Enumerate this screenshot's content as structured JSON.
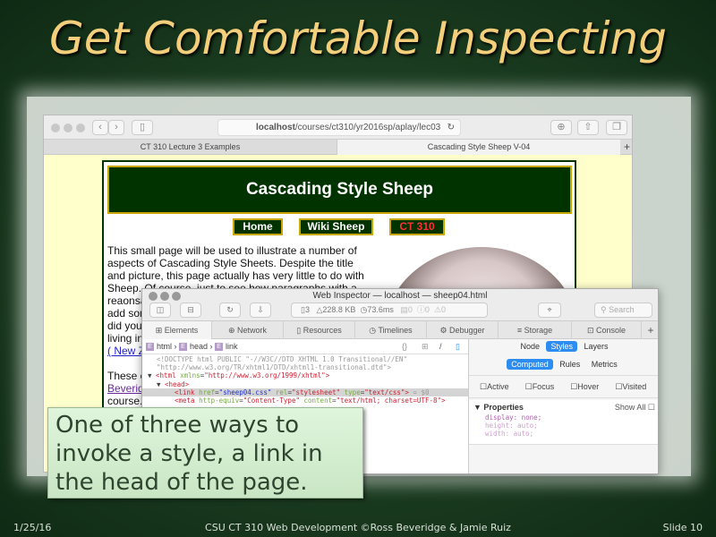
{
  "slide": {
    "title": "Get Comfortable Inspecting",
    "callout": "One of three ways to invoke a style, a link in the head of the page.",
    "footer_date": "1/25/16",
    "footer_center": "CSU CT 310 Web Development ©Ross Beveridge & Jamie Ruiz",
    "footer_slide": "Slide 10"
  },
  "browser": {
    "url_host": "localhost",
    "url_path": "/courses/ct310/yr2016sp/aplay/lec03",
    "tabs": [
      "CT 310 Lecture 3 Examples",
      "Cascading Style Sheep V-04"
    ],
    "new_tab": "+"
  },
  "page": {
    "heading": "Cascading Style Sheep",
    "nav": [
      "Home",
      "Wiki Sheep",
      "CT 310"
    ],
    "para1_lines": [
      "This small page will be used to illustrate a number of",
      "aspects of Cascading Style Sheets. Despite the title",
      "and picture, this page actually has very little to do with",
      "Sheep. Of course, just to see how paragraphs with a",
      "reaonsa",
      "add som",
      "did you",
      "living in"
    ],
    "link1": "( New Z",
    "para2": "These e",
    "link2": "Beveridg",
    "para2_end": "course."
  },
  "inspector": {
    "title": "Web Inspector — localhost — sheep04.html",
    "stats": {
      "resources": "3",
      "size": "228.8 KB",
      "time": "73.6ms",
      "logs": "0",
      "errors": "0",
      "warnings": "0"
    },
    "search_placeholder": "Search",
    "tabs": [
      "Elements",
      "Network",
      "Resources",
      "Timelines",
      "Debugger",
      "Storage",
      "Console"
    ],
    "breadcrumbs": [
      "html",
      "head",
      "link"
    ],
    "dom": {
      "doctype1": "<!DOCTYPE html PUBLIC \"-//W3C//DTD XHTML 1.0 Transitional//EN\"",
      "doctype2": "\"http://www.w3.org/TR/xhtml1/DTD/xhtml1-transitional.dtd\">",
      "html_xmlns": "http://www.w3.org/1999/xhtml",
      "link_href": "sheep04.css",
      "link_rel": "stylesheet",
      "link_type": "text/css",
      "sel_marker": "= $0",
      "meta_equiv": "Content-Type",
      "meta_content": "text/html; charset=UTF-8"
    },
    "side_tabs": [
      "Node",
      "Styles",
      "Layers"
    ],
    "sub_tabs": [
      "Computed",
      "Rules",
      "Metrics"
    ],
    "states": [
      "Active",
      "Focus",
      "Hover",
      "Visited"
    ],
    "properties_label": "Properties",
    "show_all": "Show All",
    "properties": [
      "display: none;",
      "height: auto;",
      "width: auto;"
    ]
  }
}
